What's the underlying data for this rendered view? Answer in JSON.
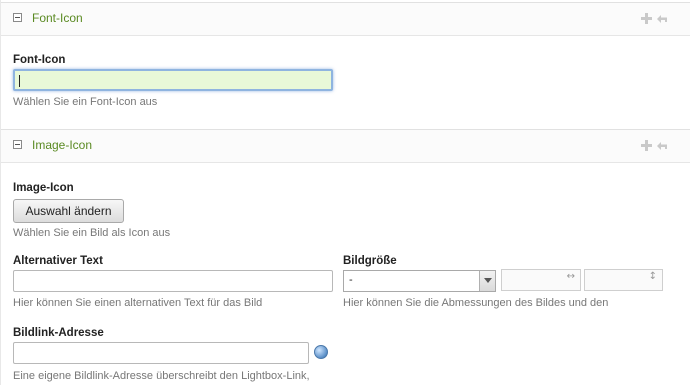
{
  "font_icon_section": {
    "title": "Font-Icon",
    "field_label": "Font-Icon",
    "input_value": "",
    "hint": "Wählen Sie ein Font-Icon aus"
  },
  "image_icon_section": {
    "title": "Image-Icon",
    "field_label": "Image-Icon",
    "button_label": "Auswahl ändern",
    "hint": "Wählen Sie ein Bild als Icon aus",
    "alt_text": {
      "label": "Alternativer Text",
      "value": "",
      "hint": "Hier können Sie einen alternativen Text für das Bild"
    },
    "image_size": {
      "label": "Bildgröße",
      "selected": "-",
      "width_value": "",
      "height_value": "",
      "hint": "Hier können Sie die Abmessungen des Bildes und den"
    },
    "link": {
      "label": "Bildlink-Adresse",
      "value": "",
      "hint": "Eine eigene Bildlink-Adresse überschreibt den Lightbox-Link,"
    }
  },
  "icons": {
    "collapse": "minus-square-icon",
    "add": "plus-icon",
    "undo": "undo-arrow-icon",
    "width_arrows": "↔",
    "height_arrows": "↕",
    "picker": "globe-icon"
  },
  "colors": {
    "section_title": "#5a8a22",
    "focus_fill": "#e8f8d8",
    "focus_border": "#8fb4e0"
  }
}
